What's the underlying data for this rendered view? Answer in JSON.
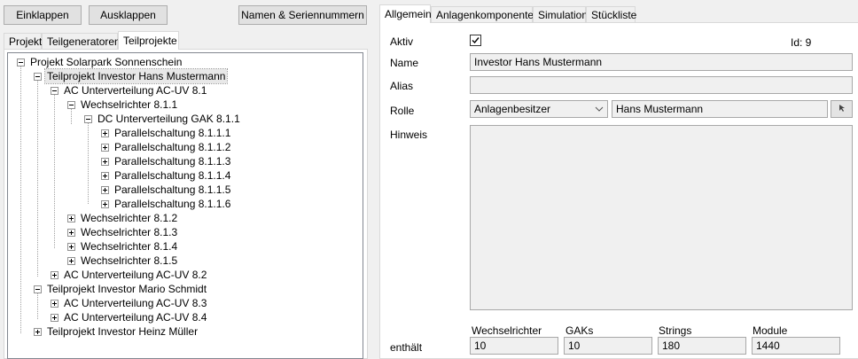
{
  "toolbar": {
    "collapse_label": "Einklappen",
    "expand_label": "Ausklappen",
    "names_serials_label": "Namen & Seriennummern"
  },
  "left_tabs": [
    "Projekt",
    "Teilgeneratoren",
    "Teilprojekte"
  ],
  "right_tabs": [
    "Allgemein",
    "Anlagenkomponenten",
    "Simulation",
    "Stückliste"
  ],
  "tree": [
    {
      "label": "Projekt Solarpark Sonnenschein",
      "expander": "minus"
    },
    {
      "label": "Teilprojekt Investor Hans Mustermann",
      "expander": "minus",
      "selected": true
    },
    {
      "label": "AC Unterverteilung AC-UV 8.1",
      "expander": "minus"
    },
    {
      "label": "Wechselrichter 8.1.1",
      "expander": "minus"
    },
    {
      "label": "DC Unterverteilung GAK 8.1.1",
      "expander": "minus"
    },
    {
      "label": "Parallelschaltung 8.1.1.1",
      "expander": "plus"
    },
    {
      "label": "Parallelschaltung 8.1.1.2",
      "expander": "plus"
    },
    {
      "label": "Parallelschaltung 8.1.1.3",
      "expander": "plus"
    },
    {
      "label": "Parallelschaltung 8.1.1.4",
      "expander": "plus"
    },
    {
      "label": "Parallelschaltung 8.1.1.5",
      "expander": "plus"
    },
    {
      "label": "Parallelschaltung 8.1.1.6",
      "expander": "plus"
    },
    {
      "label": "Wechselrichter 8.1.2",
      "expander": "plus"
    },
    {
      "label": "Wechselrichter 8.1.3",
      "expander": "plus"
    },
    {
      "label": "Wechselrichter 8.1.4",
      "expander": "plus"
    },
    {
      "label": "Wechselrichter 8.1.5",
      "expander": "plus"
    },
    {
      "label": "AC Unterverteilung AC-UV 8.2",
      "expander": "plus"
    },
    {
      "label": "Teilprojekt Investor Mario Schmidt",
      "expander": "minus"
    },
    {
      "label": "AC Unterverteilung AC-UV 8.3",
      "expander": "plus"
    },
    {
      "label": "AC Unterverteilung AC-UV 8.4",
      "expander": "plus"
    },
    {
      "label": "Teilprojekt Investor Heinz Müller",
      "expander": "plus"
    }
  ],
  "form": {
    "active_label": "Aktiv",
    "active_checked": true,
    "id_text": "Id: 9",
    "name_label": "Name",
    "name_value": "Investor Hans Mustermann",
    "alias_label": "Alias",
    "alias_value": "",
    "role_label": "Rolle",
    "role_selected": "Anlagenbesitzer",
    "role_person": "Hans Mustermann",
    "note_label": "Hinweis",
    "note_value": "",
    "contains_label": "enthält",
    "counts": [
      {
        "label": "Wechselrichter",
        "value": "10"
      },
      {
        "label": "GAKs",
        "value": "10"
      },
      {
        "label": "Strings",
        "value": "180"
      },
      {
        "label": "Module",
        "value": "1440"
      }
    ]
  },
  "icons": {
    "role_picker": "picker-icon",
    "checkbox": "checkmark-icon"
  }
}
